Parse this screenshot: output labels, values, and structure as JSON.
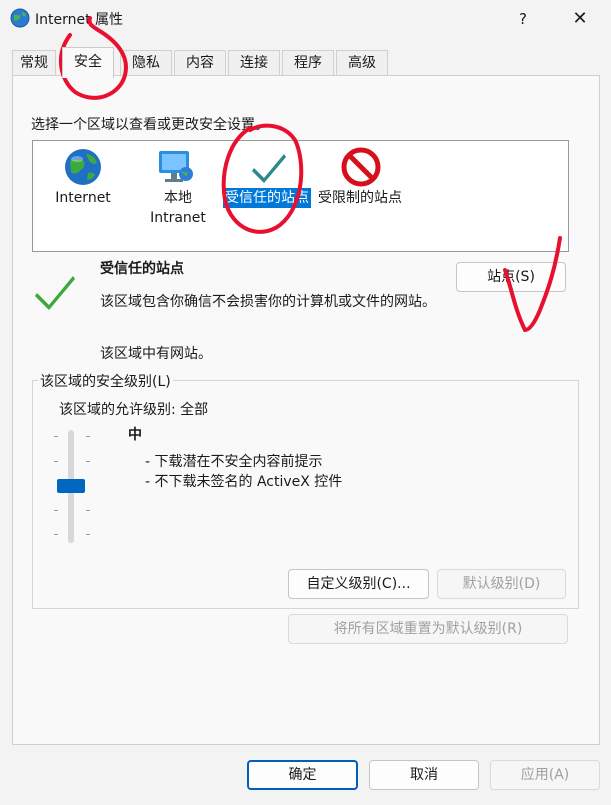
{
  "window": {
    "title": "Internet 属性",
    "help_label": "?",
    "close_label": "✕",
    "icon": "internet-options-globe-icon"
  },
  "tabs": [
    {
      "label": "常规",
      "active": false
    },
    {
      "label": "安全",
      "active": true
    },
    {
      "label": "隐私",
      "active": false
    },
    {
      "label": "内容",
      "active": false
    },
    {
      "label": "连接",
      "active": false
    },
    {
      "label": "程序",
      "active": false
    },
    {
      "label": "高级",
      "active": false
    }
  ],
  "security": {
    "zone_prompt": "选择一个区域以查看或更改安全设置。",
    "zones": [
      {
        "label": "Internet",
        "icon": "globe-icon",
        "selected": false
      },
      {
        "label": "本地\nIntranet",
        "icon": "monitor-network-icon",
        "selected": false
      },
      {
        "label": "受信任的站点",
        "icon": "checkmark-icon",
        "selected": true
      },
      {
        "label": "受限制的站点",
        "icon": "no-entry-icon",
        "selected": false
      }
    ],
    "selected_zone": {
      "title": "受信任的站点",
      "description": "该区域包含你确信不会损害你的计算机或文件的网站。",
      "sites_status": "该区域中有网站。",
      "sites_button": "站点(S)"
    },
    "level_group": {
      "legend": "该区域的安全级别(L)",
      "allowed_levels": "该区域的允许级别: 全部",
      "level_name": "中",
      "level_details": [
        "- 下载潜在不安全内容前提示",
        "- 不下载未签名的 ActiveX 控件"
      ],
      "slider_level": "中",
      "custom_button": "自定义级别(C)...",
      "default_button": "默认级别(D)"
    },
    "reset_all_button": "将所有区域重置为默认级别(R)"
  },
  "footer": {
    "ok": "确定",
    "cancel": "取消",
    "apply": "应用(A)"
  },
  "colors": {
    "accent": "#0067c0",
    "selection": "#0078d7",
    "annotation_ink": "#e8102e",
    "check_green": "#2ea043",
    "restricted_red": "#d6101a"
  }
}
